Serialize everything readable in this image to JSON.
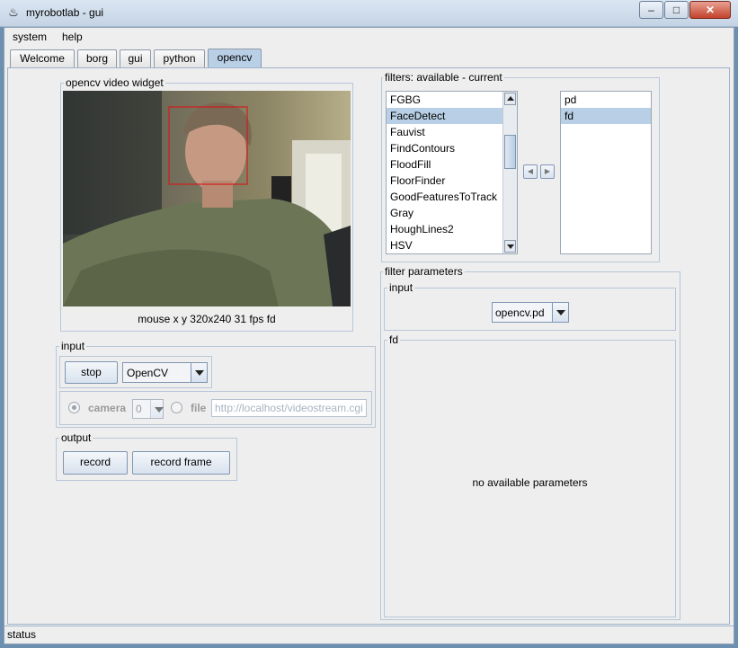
{
  "window": {
    "title": "myrobotlab - gui",
    "min": "–",
    "max": "□",
    "close": "✕",
    "icon": "java-icon"
  },
  "menu": [
    "system",
    "help"
  ],
  "tabs": [
    "Welcome",
    "borg",
    "gui",
    "python",
    "opencv"
  ],
  "active_tab": "opencv",
  "video": {
    "title": "opencv  video widget",
    "status": "mouse x y  320x240  31 fps  fd"
  },
  "input": {
    "title": "input",
    "stop_label": "stop",
    "source_value": "OpenCV",
    "camera_label": "camera",
    "camera_index": "0",
    "file_label": "file",
    "file_value": "http://localhost/videostream.cgi"
  },
  "output": {
    "title": "output",
    "record_label": "record",
    "record_frame_label": "record frame"
  },
  "filters": {
    "title": "filters: available - current",
    "available": [
      "FGBG",
      "FaceDetect",
      "Fauvist",
      "FindContours",
      "FloodFill",
      "FloorFinder",
      "GoodFeaturesToTrack",
      "Gray",
      "HoughLines2",
      "HSV"
    ],
    "available_selected": "FaceDetect",
    "current": [
      "pd",
      "fd"
    ],
    "current_selected": "fd",
    "move_left": "◀",
    "move_right": "▶"
  },
  "filter_parameters": {
    "title": "filter parameters",
    "input_title": "input",
    "input_value": "opencv.pd",
    "section_title": "fd",
    "empty_message": "no available parameters"
  },
  "status": "status"
}
